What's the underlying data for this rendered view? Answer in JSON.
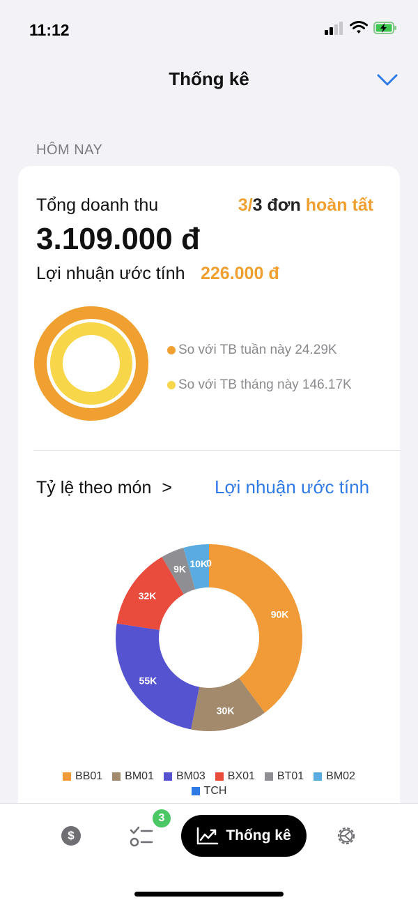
{
  "status": {
    "time": "11:12"
  },
  "header": {
    "title": "Thống kê"
  },
  "section": {
    "today": "HÔM NAY"
  },
  "summary": {
    "revenue_label": "Tổng doanh thu",
    "orders_done": "3",
    "orders_slash": "/",
    "orders_total": "3",
    "orders_word": " đơn ",
    "orders_status": "hoàn tất",
    "revenue_value": "3.109.000 đ",
    "profit_label": "Lợi nhuận ước tính",
    "profit_value": "226.000 đ"
  },
  "comparison": {
    "week_label": "So với TB tuần này 24.29K",
    "month_label": "So với TB tháng này 146.17K",
    "week_color": "#f0a030",
    "month_color": "#f7d64a",
    "week_fill": 1.0,
    "month_fill": 1.0
  },
  "ratio": {
    "title": "Tỷ lệ theo món",
    "arrow": ">",
    "metric_link": "Lợi nhuận ước tính"
  },
  "chart_data": {
    "type": "pie",
    "donut": true,
    "series": [
      {
        "name": "BB01",
        "value": 90,
        "label": "90K",
        "color": "#f09a38"
      },
      {
        "name": "BM01",
        "value": 30,
        "label": "30K",
        "color": "#a38a6d"
      },
      {
        "name": "BM03",
        "value": 55,
        "label": "55K",
        "color": "#5553d0"
      },
      {
        "name": "BX01",
        "value": 32,
        "label": "32K",
        "color": "#e94c3d"
      },
      {
        "name": "BT01",
        "value": 9,
        "label": "9K",
        "color": "#8e8e93"
      },
      {
        "name": "BM02",
        "value": 10,
        "label": "10K",
        "color": "#5aace0"
      },
      {
        "name": "TCH",
        "value": 0,
        "label": "0",
        "color": "#2f7ae5"
      }
    ]
  },
  "tabs": {
    "list_badge": "3",
    "active_label": "Thống kê"
  }
}
